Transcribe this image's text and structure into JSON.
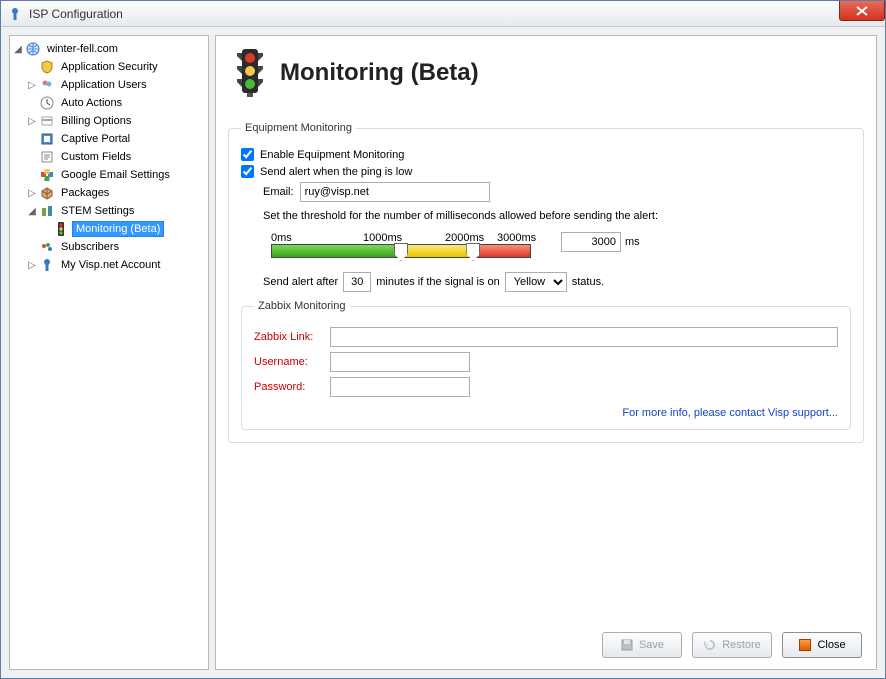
{
  "window": {
    "title": "ISP Configuration"
  },
  "tree": {
    "root": "winter-fell.com",
    "items": [
      {
        "label": "Application Security",
        "icon": "shield-icon",
        "exp": ""
      },
      {
        "label": "Application Users",
        "icon": "users-icon",
        "exp": "▷"
      },
      {
        "label": "Auto Actions",
        "icon": "clock-icon",
        "exp": ""
      },
      {
        "label": "Billing Options",
        "icon": "billing-icon",
        "exp": "▷"
      },
      {
        "label": "Captive Portal",
        "icon": "portal-icon",
        "exp": ""
      },
      {
        "label": "Custom Fields",
        "icon": "fields-icon",
        "exp": ""
      },
      {
        "label": "Google Email Settings",
        "icon": "google-icon",
        "exp": ""
      },
      {
        "label": "Packages",
        "icon": "packages-icon",
        "exp": "▷"
      },
      {
        "label": "STEM Settings",
        "icon": "stem-icon",
        "exp": "◢"
      },
      {
        "label": "Subscribers",
        "icon": "subscribers-icon",
        "exp": ""
      },
      {
        "label": "My Visp.net Account",
        "icon": "account-icon",
        "exp": "▷"
      }
    ],
    "stem_child": "Monitoring (Beta)"
  },
  "page": {
    "title": "Monitoring (Beta)"
  },
  "equip": {
    "legend": "Equipment Monitoring",
    "enable_label": "Enable Equipment Monitoring",
    "enable_checked": true,
    "alert_label": "Send alert when the ping is low",
    "alert_checked": true,
    "email_label": "Email:",
    "email_value": "ruy@visp.net",
    "thresh_intro": "Set the threshold for the number of milliseconds allowed before sending the alert:",
    "ticks": {
      "t0": "0ms",
      "t1": "1000ms",
      "t2": "2000ms",
      "t3": "3000ms"
    },
    "thresh_value": "3000",
    "thresh_unit": "ms",
    "after_prefix": "Send alert after",
    "after_value": "30",
    "after_mid": "minutes if the signal is on",
    "after_select": "Yellow",
    "after_suffix": "status."
  },
  "zab": {
    "legend": "Zabbix Monitoring",
    "link_label": "Zabbix Link:",
    "link_value": "",
    "user_label": "Username:",
    "user_value": "",
    "pass_label": "Password:",
    "pass_value": "",
    "support": "For more info, please contact Visp support..."
  },
  "footer": {
    "save": "Save",
    "restore": "Restore",
    "close": "Close"
  }
}
